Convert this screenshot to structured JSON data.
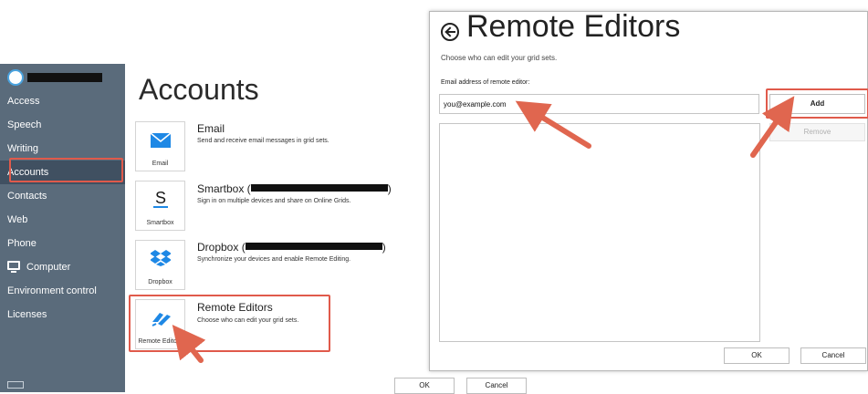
{
  "sidebar": {
    "items": [
      {
        "label": "Access"
      },
      {
        "label": "Speech"
      },
      {
        "label": "Writing"
      },
      {
        "label": "Accounts"
      },
      {
        "label": "Contacts"
      },
      {
        "label": "Web"
      },
      {
        "label": "Phone"
      },
      {
        "label": "Computer"
      },
      {
        "label": "Environment control"
      },
      {
        "label": "Licenses"
      }
    ]
  },
  "accounts": {
    "title": "Accounts",
    "items": [
      {
        "name": "Email",
        "desc": "Send and receive email messages in grid sets.",
        "tile": "Email",
        "icon": "envelope-icon"
      },
      {
        "name": "Smartbox (",
        "name_end": ")",
        "desc": "Sign in on multiple devices and share on Online Grids.",
        "tile": "Smartbox",
        "icon": "smartbox-icon"
      },
      {
        "name": "Dropbox (",
        "name_end": ")",
        "desc": "Synchronize your devices and enable Remote Editing.",
        "tile": "Dropbox",
        "icon": "dropbox-icon"
      },
      {
        "name": "Remote Editors",
        "desc": "Choose who can edit your grid sets.",
        "tile": "Remote Editors",
        "icon": "remote-editors-icon"
      }
    ],
    "ok_label": "OK",
    "cancel_label": "Cancel"
  },
  "dialog": {
    "title": "Remote Editors",
    "subtitle": "Choose who can edit your grid sets.",
    "email_label": "Email address of remote editor:",
    "email_value": "you@example.com",
    "add_label": "Add",
    "remove_label": "Remove",
    "ok_label": "OK",
    "cancel_label": "Cancel"
  },
  "colors": {
    "sidebar": "#5a6b7b",
    "sidebar_selected": "#405061",
    "highlight": "#e05a4b",
    "brand_blue": "#1e88e5"
  }
}
